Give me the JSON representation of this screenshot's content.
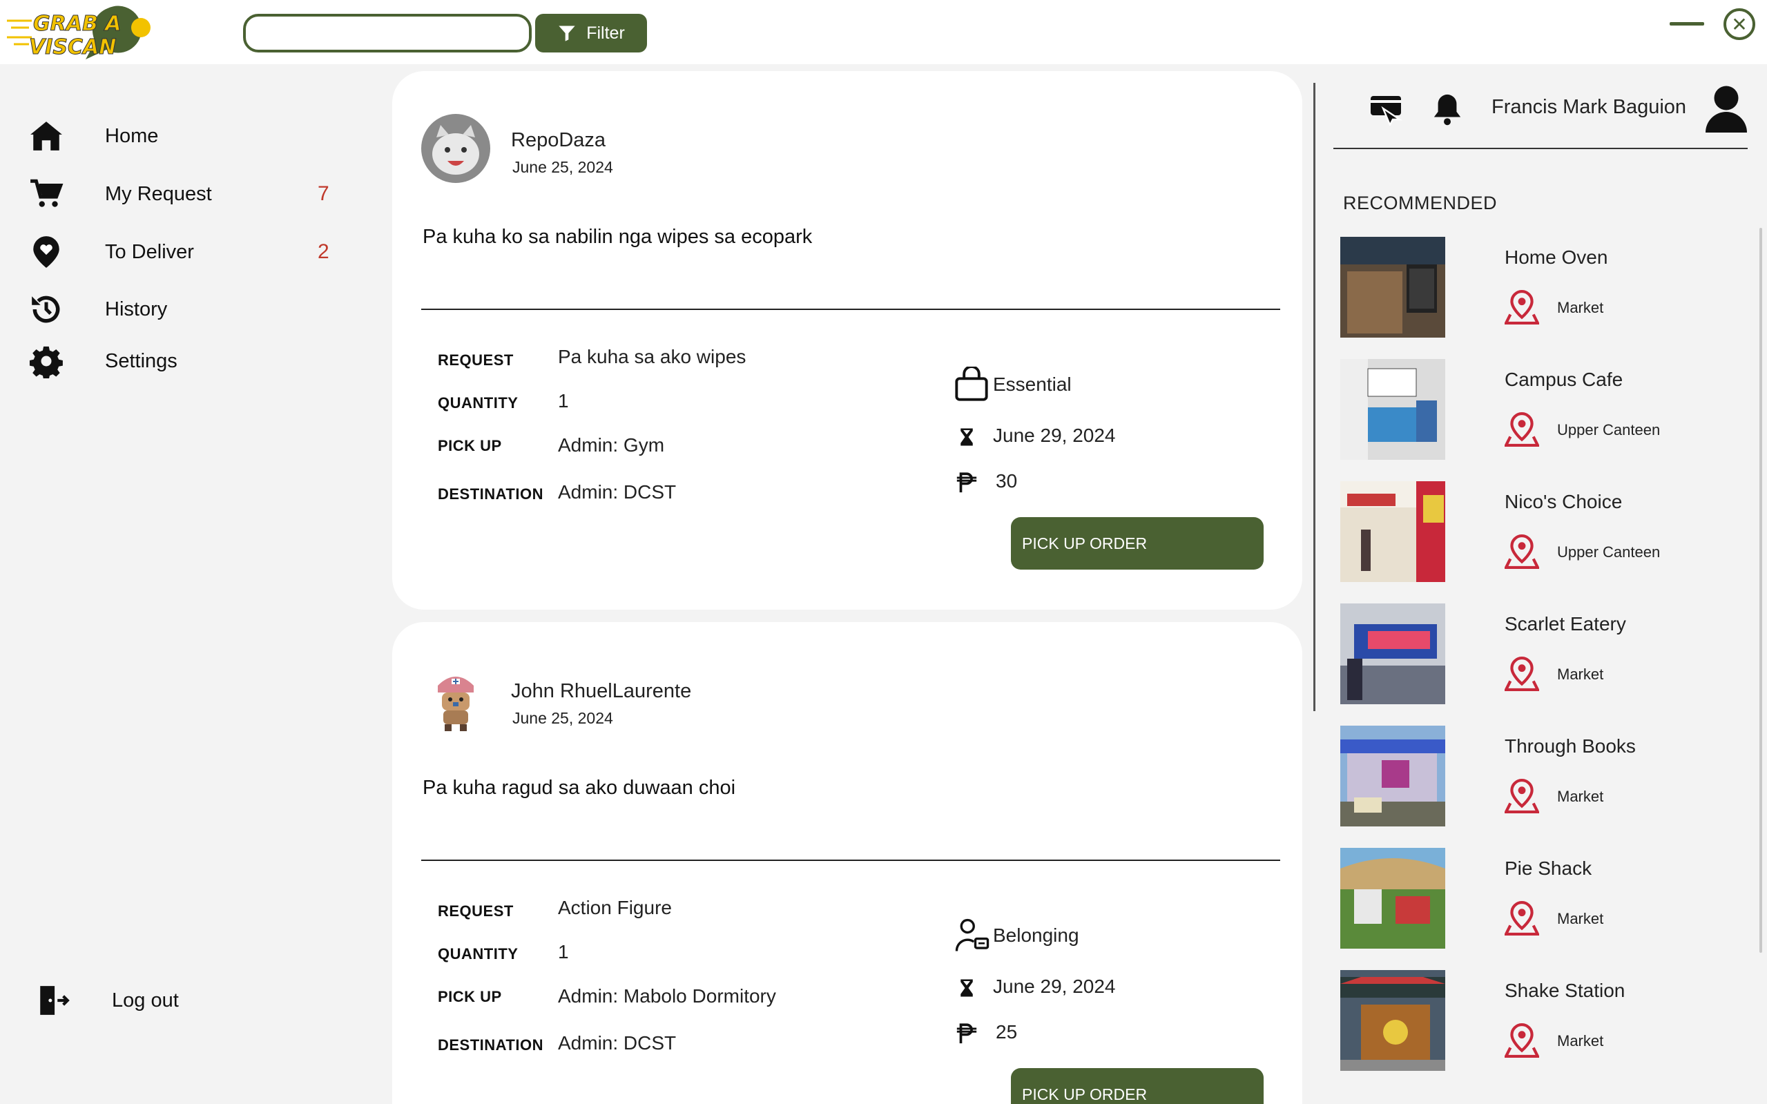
{
  "app": {
    "logo_text_line1": "GRAB A",
    "logo_text_line2": "VISCAN"
  },
  "search": {
    "value": "",
    "placeholder": ""
  },
  "filter": {
    "label": "Filter"
  },
  "sidebar": {
    "items": [
      {
        "label": "Home",
        "icon": "home-icon",
        "count": ""
      },
      {
        "label": "My Request",
        "icon": "cart-icon",
        "count": "7"
      },
      {
        "label": "To Deliver",
        "icon": "location-heart-icon",
        "count": "2"
      },
      {
        "label": "History",
        "icon": "history-icon",
        "count": ""
      },
      {
        "label": "Settings",
        "icon": "gear-icon",
        "count": ""
      }
    ],
    "logout": "Log out"
  },
  "posts": [
    {
      "author": "RepoDaza",
      "date": "June 25, 2024",
      "text": "Pa kuha ko sa nabilin nga wipes sa ecopark",
      "labels": {
        "request": "REQUEST",
        "quantity": "QUANTITY",
        "pickup": "PICK UP",
        "destination": "DESTINATION"
      },
      "request": "Pa kuha sa ako wipes",
      "quantity": "1",
      "pickup": "Admin: Gym",
      "destination": "Admin: DCST",
      "category": "Essential",
      "deadline": "June 29, 2024",
      "fee": "30",
      "button": "PICK UP ORDER"
    },
    {
      "author": "John RhuelLaurente",
      "date": "June 25, 2024",
      "text": "Pa kuha ragud sa ako duwaan choi",
      "labels": {
        "request": "REQUEST",
        "quantity": "QUANTITY",
        "pickup": "PICK UP",
        "destination": "DESTINATION"
      },
      "request": "Action Figure",
      "quantity": "1",
      "pickup": "Admin: Mabolo Dormitory",
      "destination": "Admin: DCST",
      "category": "Belonging",
      "deadline": "June 29, 2024",
      "fee": "25",
      "button": "PICK UP ORDER"
    }
  ],
  "user": {
    "name": "Francis Mark Baguion"
  },
  "recommended": {
    "title": "RECOMMENDED",
    "items": [
      {
        "name": "Home Oven",
        "location": "Market"
      },
      {
        "name": "Campus Cafe",
        "location": "Upper Canteen"
      },
      {
        "name": "Nico's Choice",
        "location": "Upper Canteen"
      },
      {
        "name": "Scarlet Eatery",
        "location": "Market"
      },
      {
        "name": "Through Books",
        "location": "Market"
      },
      {
        "name": "Pie Shack",
        "location": "Market"
      },
      {
        "name": "Shake Station",
        "location": "Market"
      }
    ]
  },
  "colors": {
    "accent": "#4a6132",
    "count_red": "#c0392b",
    "pin_red": "#c8283a",
    "logo_yellow": "#f2c200"
  }
}
